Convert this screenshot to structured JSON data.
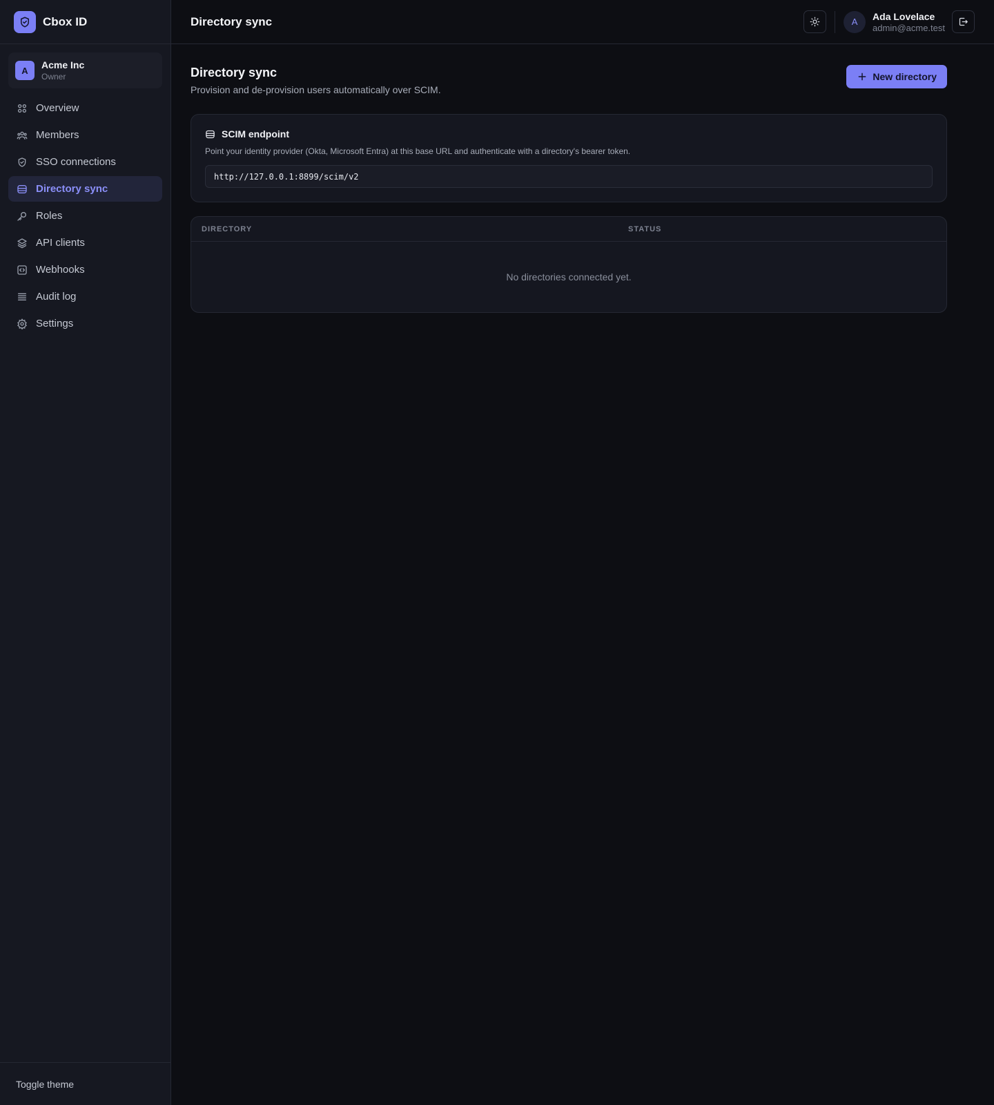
{
  "brand": {
    "name": "Cbox ID"
  },
  "org": {
    "initial": "A",
    "name": "Acme Inc",
    "role": "Owner"
  },
  "sidebar": {
    "items": [
      {
        "label": "Overview",
        "icon": "grid-icon",
        "active": false
      },
      {
        "label": "Members",
        "icon": "users-icon",
        "active": false
      },
      {
        "label": "SSO connections",
        "icon": "shield-check-icon",
        "active": false
      },
      {
        "label": "Directory sync",
        "icon": "database-icon",
        "active": true
      },
      {
        "label": "Roles",
        "icon": "key-icon",
        "active": false
      },
      {
        "label": "API clients",
        "icon": "layers-icon",
        "active": false
      },
      {
        "label": "Webhooks",
        "icon": "code-square-icon",
        "active": false
      },
      {
        "label": "Audit log",
        "icon": "list-icon",
        "active": false
      },
      {
        "label": "Settings",
        "icon": "gear-icon",
        "active": false
      }
    ],
    "footer": "Toggle theme"
  },
  "topbar": {
    "title": "Directory sync",
    "user": {
      "initial": "A",
      "name": "Ada Lovelace",
      "email": "admin@acme.test"
    }
  },
  "page": {
    "title": "Directory sync",
    "subtitle": "Provision and de-provision users automatically over SCIM.",
    "new_button": "New directory"
  },
  "scim": {
    "title": "SCIM endpoint",
    "description": "Point your identity provider (Okta, Microsoft Entra) at this base URL and authenticate with a directory's bearer token.",
    "url": "http://127.0.0.1:8899/scim/v2"
  },
  "table": {
    "columns": [
      "DIRECTORY",
      "STATUS"
    ],
    "empty": "No directories connected yet."
  },
  "colors": {
    "accent": "#7b7ff5",
    "background": "#0d0e13",
    "sidebar": "#161821"
  }
}
